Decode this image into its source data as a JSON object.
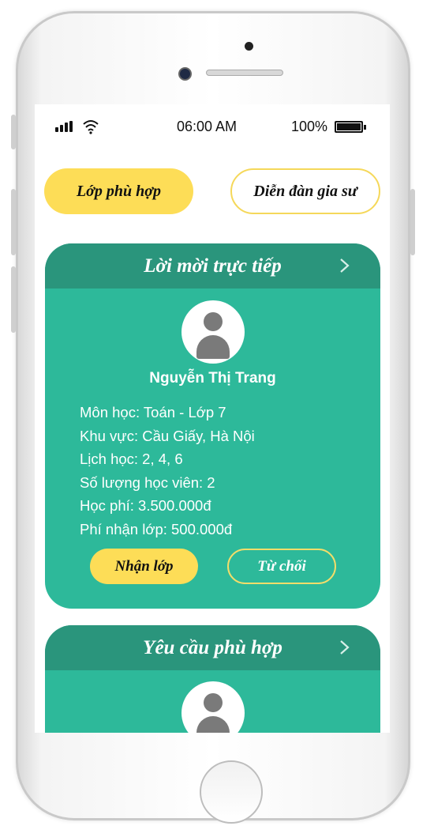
{
  "status_bar": {
    "time": "06:00 AM",
    "battery_percent": "100%",
    "battery_level": 1.0
  },
  "tabs": {
    "matching_classes": "Lớp phù hợp",
    "tutor_forum": "Diễn đàn gia sư"
  },
  "invitation_card": {
    "title": "Lời mời trực tiếp",
    "name": "Nguyễn Thị Trang",
    "details": [
      "Môn học: Toán - Lớp 7",
      "Khu vực: Cầu Giấy, Hà Nội",
      "Lịch học: 2, 4, 6",
      "Số lượng học viên: 2",
      "Học phí: 3.500.000đ",
      "Phí nhận lớp: 500.000đ"
    ],
    "accept_label": "Nhận lớp",
    "reject_label": "Từ chối"
  },
  "requests_card": {
    "title": "Yêu cầu phù hợp"
  },
  "colors": {
    "accent_yellow": "#fddd57",
    "card_green": "#2db99a",
    "card_header_green": "#2a957c"
  },
  "icons": [
    "signal-icon",
    "wifi-icon",
    "battery-icon",
    "chevron-right-icon",
    "user-avatar-icon"
  ]
}
